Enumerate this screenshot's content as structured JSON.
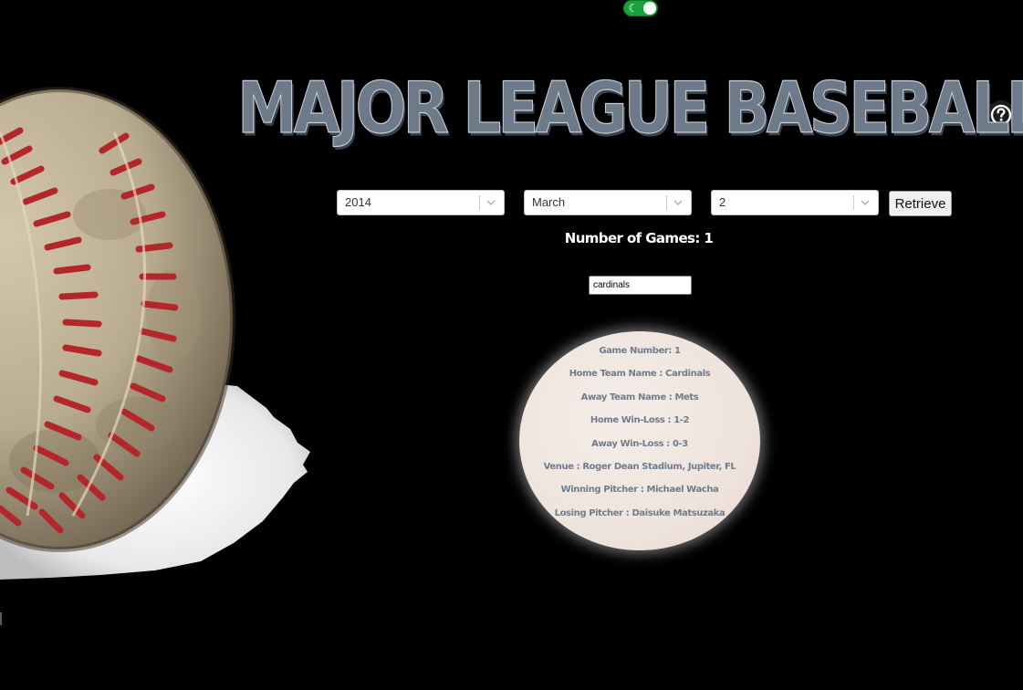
{
  "header": {
    "title": "MAJOR LEAGUE BASEBALL",
    "theme_toggle_icon": "moon-icon",
    "help_icon": "question-circle-icon"
  },
  "filters": {
    "year": "2014",
    "month": "March",
    "day": "2",
    "retrieve_label": "Retrieve"
  },
  "summary": {
    "games_count_text": "Number of Games: 1"
  },
  "search": {
    "value": "cardinals"
  },
  "game": {
    "number": "Game Number: 1",
    "home_team": "Home Team Name : Cardinals",
    "away_team": "Away Team Name : Mets",
    "home_record": "Home Win-Loss : 1-2",
    "away_record": "Away Win-Loss : 0-3",
    "venue": "Venue : Roger Dean Stadium, Jupiter, FL",
    "winning_pitcher": "Winning Pitcher : Michael Wacha",
    "losing_pitcher": "Losing Pitcher : Daisuke Matsuzaka"
  },
  "colors": {
    "background": "#000000",
    "title": "#6c7a89",
    "card_text": "#6f7c8b",
    "card_bg": "#f0e6df",
    "toggle": "#1aa33a"
  }
}
